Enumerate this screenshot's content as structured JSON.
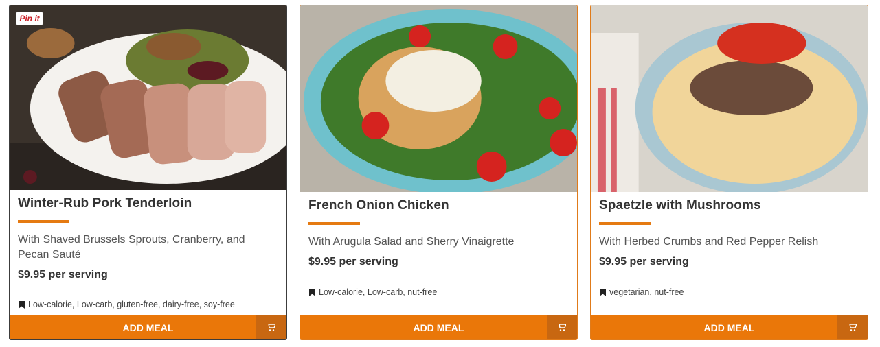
{
  "pin_label": "Pin it",
  "add_label": "ADD MEAL",
  "accent_color": "#ea7709",
  "meals": [
    {
      "title": "Winter-Rub Pork Tenderloin",
      "subtitle": "With Shaved Brussels Sprouts, Cranberry, and Pecan Sauté",
      "price": "$9.95 per serving",
      "tags": "Low-calorie, Low-carb, gluten-free, dairy-free, soy-free"
    },
    {
      "title": "French Onion Chicken",
      "subtitle": "With Arugula Salad and Sherry Vinaigrette",
      "price": "$9.95 per serving",
      "tags": "Low-calorie, Low-carb, nut-free"
    },
    {
      "title": "Spaetzle with Mushrooms",
      "subtitle": "With Herbed Crumbs and Red Pepper Relish",
      "price": "$9.95 per serving",
      "tags": "vegetarian, nut-free"
    }
  ]
}
